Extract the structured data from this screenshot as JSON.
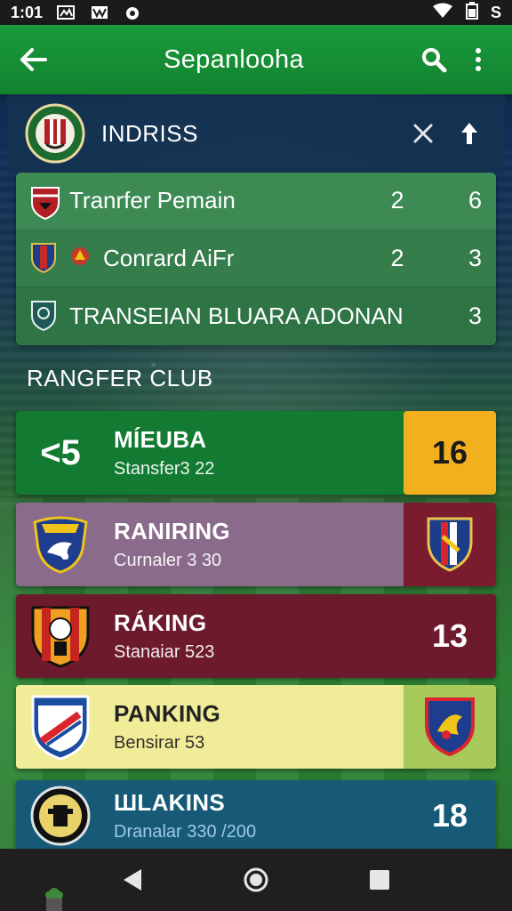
{
  "status_bar": {
    "time": "1:01",
    "battery_text": "S"
  },
  "app_bar": {
    "title": "Sepanlooha"
  },
  "league": {
    "name": "INDRISS"
  },
  "matches": [
    {
      "name": "Tranrfer Pemain",
      "score1": "2",
      "score2": "6"
    },
    {
      "name": "Conrard AiFr",
      "score1": "2",
      "score2": "3"
    },
    {
      "name": "TRANSEIAN BLUARA ADONAN",
      "score1": "",
      "score2": "3"
    }
  ],
  "section": {
    "title": "RANGFER CLUB"
  },
  "rankings": [
    {
      "lead": "<5",
      "name": "MÍEUBA",
      "sub": "Stansfer3 22",
      "value": "16"
    },
    {
      "name": "RANIRING",
      "sub": "Curnaler 3 30",
      "value": ""
    },
    {
      "name": "RÁKING",
      "sub": "Stanaiar 523",
      "value": "13"
    },
    {
      "name": "PANKING",
      "sub": "Bensirar 53",
      "value": ""
    },
    {
      "name": "ШLAKINS",
      "sub": "Dranalar 330 /200",
      "value": "18"
    }
  ],
  "colors": {
    "app_bar": "#1a9a3c",
    "highlight": "#f2b01e",
    "card_green": "#137a32",
    "card_purple": "#8b6b8c",
    "card_maroon": "#6d1a2c",
    "card_yellow": "#f0ec98",
    "card_blue": "#165a78"
  },
  "icons": {
    "back": "arrow-left-icon",
    "search": "search-icon",
    "more": "more-vert-icon",
    "close": "close-icon",
    "upload": "arrow-up-icon"
  }
}
